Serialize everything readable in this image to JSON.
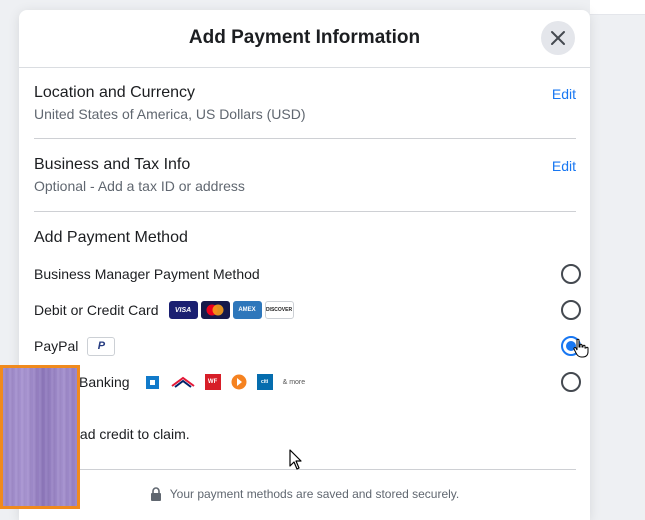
{
  "modal": {
    "title": "Add Payment Information",
    "close_icon": "close-icon"
  },
  "location": {
    "title": "Location and Currency",
    "value": "United States of America, US Dollars (USD)",
    "edit_label": "Edit"
  },
  "business": {
    "title": "Business and Tax Info",
    "value": "Optional - Add a tax ID or address",
    "edit_label": "Edit"
  },
  "payment": {
    "title": "Add Payment Method",
    "options": [
      {
        "label": "Business Manager Payment Method",
        "selected": false
      },
      {
        "label": "Debit or Credit Card",
        "selected": false,
        "card_logos": [
          "VISA",
          "mastercard",
          "AMEX",
          "DISCOVER"
        ]
      },
      {
        "label": "PayPal",
        "selected": true,
        "logo": "P"
      },
      {
        "label": "Banking",
        "selected": false,
        "bank_logos": [
          "chase",
          "bank-of-america",
          "WF",
          "usbank",
          "citi"
        ],
        "more_label": "& more"
      }
    ]
  },
  "credit": {
    "text": "ave an ad credit to claim."
  },
  "footer": {
    "secure_text": "Your payment methods are saved and stored securely.",
    "lock_icon": "lock-icon"
  },
  "colors": {
    "accent": "#1877f2",
    "thumbnail_border": "#f08a1d"
  }
}
